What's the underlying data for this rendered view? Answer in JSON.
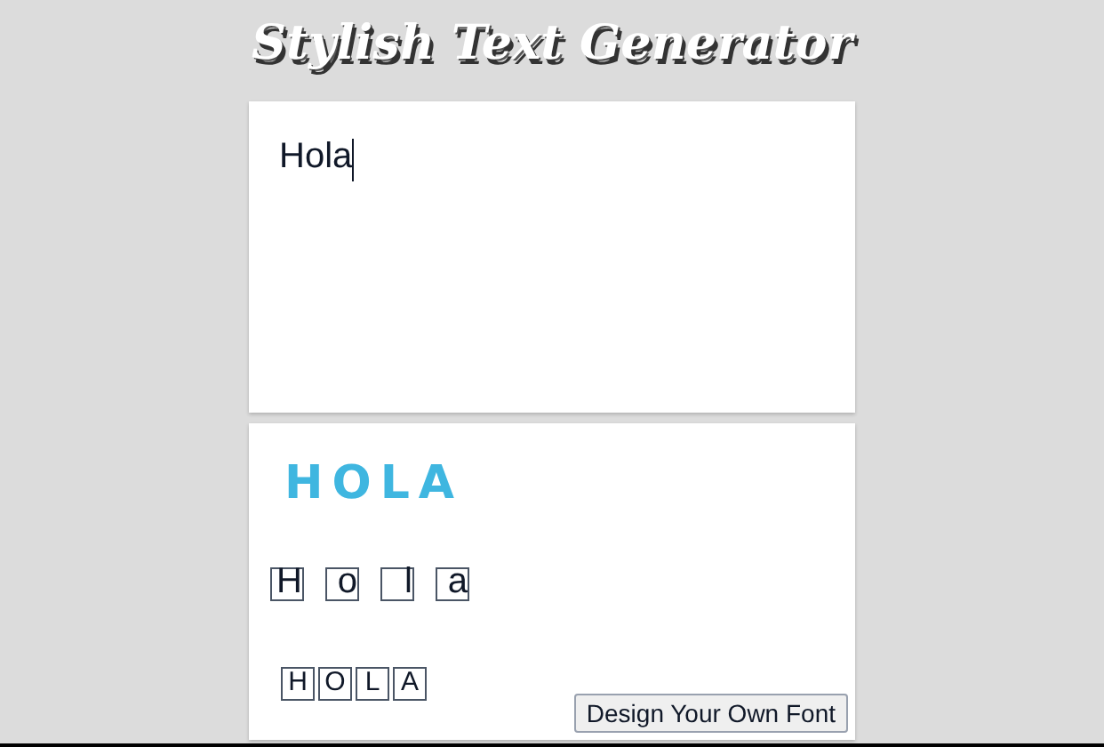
{
  "title": "Stylish Text Generator",
  "input": {
    "value": "Hola"
  },
  "results": [
    {
      "kind": "spaced",
      "text": "HOLA",
      "color": "#3fb6e0"
    },
    {
      "kind": "boxed_gap",
      "letters": [
        "H",
        "o",
        "l",
        "a"
      ]
    },
    {
      "kind": "boxed",
      "letters": [
        "H",
        "O",
        "L",
        "A"
      ]
    }
  ],
  "button": "Design Your Own Font"
}
